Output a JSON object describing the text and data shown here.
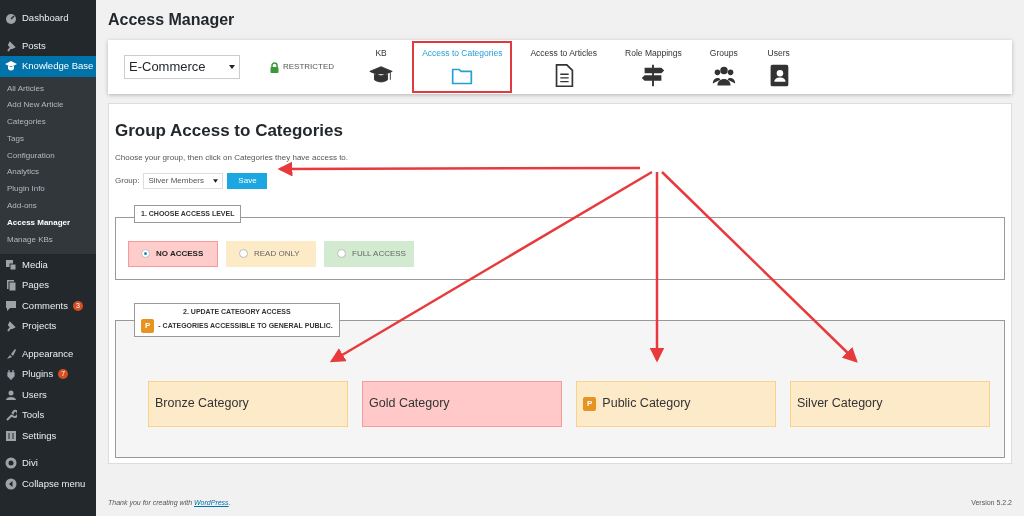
{
  "sidebar": {
    "groups": [
      [
        {
          "label": "Dashboard",
          "selected": false
        }
      ],
      [
        {
          "label": "Posts",
          "selected": false
        },
        {
          "label": "Knowledge Base",
          "selected": true,
          "children": [
            {
              "label": "All Articles",
              "selected": false
            },
            {
              "label": "Add New Article",
              "selected": false
            },
            {
              "label": "Categories",
              "selected": false
            },
            {
              "label": "Tags",
              "selected": false
            },
            {
              "label": "Configuration",
              "selected": false
            },
            {
              "label": "Analytics",
              "selected": false
            },
            {
              "label": "Plugin Info",
              "selected": false
            },
            {
              "label": "Add-ons",
              "selected": false
            },
            {
              "label": "Access Manager",
              "selected": true
            },
            {
              "label": "Manage KBs",
              "selected": false
            }
          ]
        },
        {
          "label": "Media",
          "selected": false
        },
        {
          "label": "Pages",
          "selected": false
        },
        {
          "label": "Comments",
          "selected": false,
          "badge": "3"
        },
        {
          "label": "Projects",
          "selected": false
        }
      ],
      [
        {
          "label": "Appearance",
          "selected": false
        },
        {
          "label": "Plugins",
          "selected": false,
          "badge": "7"
        },
        {
          "label": "Users",
          "selected": false
        },
        {
          "label": "Tools",
          "selected": false
        },
        {
          "label": "Settings",
          "selected": false
        }
      ],
      [
        {
          "label": "Divi",
          "selected": false
        },
        {
          "label": "Collapse menu",
          "selected": false
        }
      ]
    ]
  },
  "page_title": "Access Manager",
  "toolbar": {
    "kb_select": "E-Commerce",
    "restricted": "RESTRICTED",
    "tabs": [
      {
        "label": "KB",
        "selected": false
      },
      {
        "label": "Access to Categories",
        "selected": true
      },
      {
        "label": "Access to Articles",
        "selected": false
      },
      {
        "label": "Role Mappings",
        "selected": false
      },
      {
        "label": "Groups",
        "selected": false
      },
      {
        "label": "Users",
        "selected": false
      }
    ]
  },
  "content": {
    "heading": "Group Access to Categories",
    "intro": "Choose your group, then click on Categories they have access to.",
    "group_label": "Group:",
    "group_value": "Sliver Members",
    "save": "Save",
    "access_legend": "1. CHOOSE ACCESS LEVEL",
    "access_levels": [
      {
        "label": "NO ACCESS",
        "kind": "none",
        "selected": true
      },
      {
        "label": "READ ONLY",
        "kind": "read",
        "selected": false
      },
      {
        "label": "FULL ACCESS",
        "kind": "full",
        "selected": false
      }
    ],
    "category_legend": "2. UPDATE CATEGORY ACCESS",
    "public_badge": "P",
    "public_note": "- CATEGORIES ACCESSIBLE TO GENERAL PUBLIC.",
    "categories": [
      {
        "label": "Bronze Category",
        "kind": "read",
        "public": false
      },
      {
        "label": "Gold Category",
        "kind": "none",
        "public": false
      },
      {
        "label": "Public Category",
        "kind": "read",
        "public": true,
        "badge": "P"
      },
      {
        "label": "Silver Category",
        "kind": "read",
        "public": false
      }
    ]
  },
  "footer": {
    "thanks_prefix": "Thank you for creating with ",
    "thanks_link": "WordPress",
    "thanks_suffix": ".",
    "version": "Version 5.2.2"
  }
}
